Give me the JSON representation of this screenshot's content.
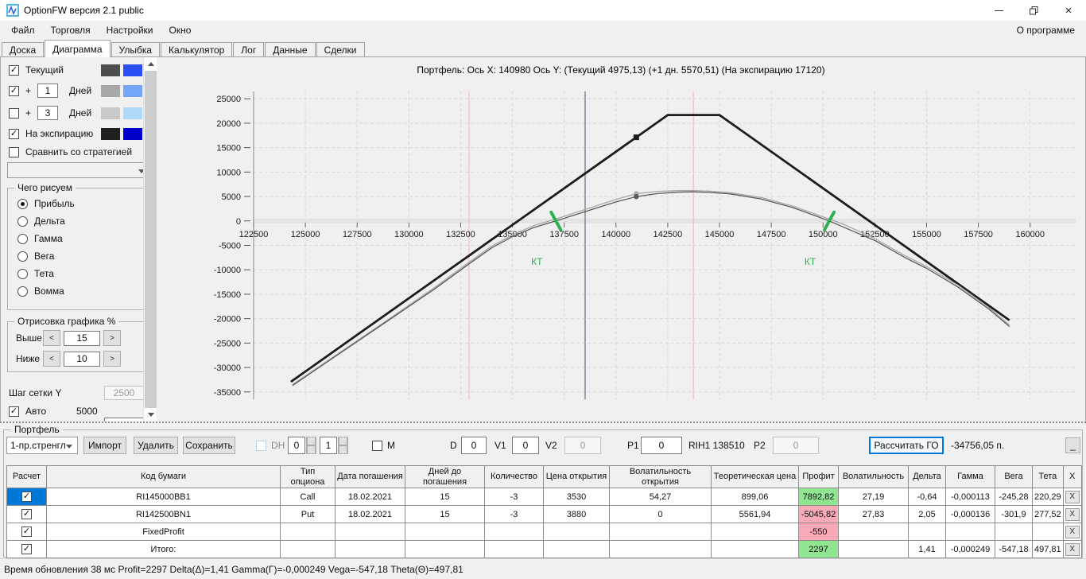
{
  "window": {
    "title": "OptionFW версия 2.1 public"
  },
  "menu": {
    "items": [
      "Файл",
      "Торговля",
      "Настройки",
      "Окно"
    ],
    "right": "О программе"
  },
  "tabs": {
    "items": [
      "Доска",
      "Диаграмма",
      "Улыбка",
      "Калькулятор",
      "Лог",
      "Данные",
      "Сделки"
    ],
    "active": "Диаграмма"
  },
  "sidebar": {
    "toggles": [
      {
        "label": "Текущий",
        "checked": true,
        "swatches": [
          "#4d4d4d",
          "#2b4df5"
        ]
      },
      {
        "prefix": "+",
        "value": "1",
        "label": "Дней",
        "checked": true,
        "swatches": [
          "#a8a8a8",
          "#74a5f7"
        ]
      },
      {
        "prefix": "+",
        "value": "3",
        "label": "Дней",
        "checked": false,
        "swatches": [
          "#c9c9c9",
          "#aed9fb"
        ]
      },
      {
        "label": "На экспирацию",
        "checked": true,
        "swatches": [
          "#1f1f1f",
          "#0000cc"
        ]
      },
      {
        "label": "Сравнить со стратегией",
        "checked": false
      }
    ],
    "strategy_dropdown_value": "",
    "draw_group": {
      "title": "Чего рисуем",
      "options": [
        "Прибыль",
        "Дельта",
        "Гамма",
        "Вега",
        "Тета",
        "Вомма"
      ],
      "selected": "Прибыль"
    },
    "range_group": {
      "title": "Отрисовка графика %",
      "rows": [
        {
          "label": "Выше",
          "value": "15"
        },
        {
          "label": "Ниже",
          "value": "10"
        }
      ],
      "dec_label": "<",
      "inc_label": ">"
    },
    "grid": {
      "label": "Шаг сетки Y",
      "value": "2500",
      "auto_label": "Авто",
      "auto_checked": true,
      "auto_value": "5000"
    }
  },
  "chart_header": "Портфель: Ось X: 140980 Ось Y:  (Текущий 4975,13)  (+1 дн. 5570,51)  (На экспирацию 17120)",
  "chart_data": {
    "type": "line",
    "title": "Портфель: Ось X: 140980 Ось Y: (Текущий 4975,13) (+1 дн. 5570,51) (На экспирацию 17120)",
    "x_axis": {
      "min": 122500,
      "max": 162200,
      "tick_step": 2500,
      "ticks": [
        122500,
        125000,
        127500,
        130000,
        132500,
        135000,
        137500,
        140000,
        142500,
        145000,
        147500,
        150000,
        152500,
        155000,
        157500,
        160000
      ]
    },
    "y_axis": {
      "min": -36500,
      "max": 26500,
      "tick_step": 5000,
      "ticks": [
        25000,
        20000,
        15000,
        10000,
        5000,
        0,
        -5000,
        -10000,
        -15000,
        -20000,
        -25000,
        -30000,
        -35000
      ]
    },
    "x_cursor": 140980,
    "underlying_line": {
      "x": 138510,
      "color": "#98a2ac"
    },
    "pink_lines": {
      "x": [
        132900,
        143740
      ],
      "color": "#f7bac7"
    },
    "breakeven_marks": [
      {
        "x": 137100,
        "label": "КТ",
        "dir": "back"
      },
      {
        "x": 150300,
        "label": "КТ",
        "dir": "fwd"
      }
    ],
    "breakeven_color": "#2fb050",
    "grid_on": true,
    "series": [
      {
        "name": "На экспирацию",
        "color": "#1c1c1c",
        "width": 2.8,
        "marker": {
          "x": 140980,
          "y": 17120,
          "shape": "square"
        },
        "points": [
          [
            124300,
            -32920
          ],
          [
            142500,
            21680
          ],
          [
            145000,
            21680
          ],
          [
            159000,
            -20320
          ]
        ]
      },
      {
        "name": "+1 Дней",
        "color": "#a8a8a8",
        "width": 1.3,
        "marker": {
          "x": 140980,
          "y": 5570.51,
          "shape": "circle"
        },
        "points": [
          [
            124376,
            -33500
          ],
          [
            126250,
            -28100
          ],
          [
            128750,
            -20900
          ],
          [
            131250,
            -13600
          ],
          [
            132837,
            -8650
          ],
          [
            134000,
            -5150
          ],
          [
            135000,
            -2850
          ],
          [
            136000,
            -1000
          ],
          [
            137100,
            400
          ],
          [
            138510,
            2350
          ],
          [
            140000,
            4400
          ],
          [
            140980,
            5570
          ],
          [
            142000,
            6050
          ],
          [
            143000,
            6200
          ],
          [
            143700,
            6230
          ],
          [
            144500,
            6100
          ],
          [
            145500,
            5800
          ],
          [
            147000,
            4800
          ],
          [
            148500,
            3100
          ],
          [
            150300,
            400
          ],
          [
            151000,
            -700
          ],
          [
            152500,
            -3600
          ],
          [
            154000,
            -7200
          ],
          [
            155000,
            -9300
          ],
          [
            156500,
            -13100
          ],
          [
            158000,
            -17700
          ],
          [
            159000,
            -21300
          ]
        ]
      },
      {
        "name": "Текущий",
        "color": "#5a5a5a",
        "width": 1.3,
        "marker": {
          "x": 140980,
          "y": 4975.13,
          "shape": "circle"
        },
        "points": [
          [
            124376,
            -33700
          ],
          [
            126250,
            -28300
          ],
          [
            128750,
            -21100
          ],
          [
            131250,
            -13900
          ],
          [
            132837,
            -9000
          ],
          [
            134000,
            -5500
          ],
          [
            135000,
            -3200
          ],
          [
            136000,
            -1400
          ],
          [
            137100,
            0
          ],
          [
            138510,
            1900
          ],
          [
            140000,
            3900
          ],
          [
            140980,
            4975
          ],
          [
            142000,
            5600
          ],
          [
            143000,
            5900
          ],
          [
            143700,
            5960
          ],
          [
            144500,
            5850
          ],
          [
            145500,
            5550
          ],
          [
            147000,
            4500
          ],
          [
            148500,
            2800
          ],
          [
            150300,
            0
          ],
          [
            151500,
            -2200
          ],
          [
            152500,
            -4000
          ],
          [
            154000,
            -7600
          ],
          [
            155000,
            -9700
          ],
          [
            156500,
            -13500
          ],
          [
            158000,
            -18000
          ],
          [
            159000,
            -21600
          ]
        ]
      }
    ]
  },
  "portfolio": {
    "group_title": "Портфель",
    "preset_dropdown": "1-пр.стренгл",
    "import_btn": "Импорт",
    "delete_btn": "Удалить",
    "save_btn": "Сохранить",
    "dh": {
      "label": "DH",
      "checked": false,
      "disabled": true
    },
    "spinner1": "0",
    "spinner2": "1",
    "m": {
      "label": "M",
      "checked": false
    },
    "d": {
      "label": "D",
      "value": "0"
    },
    "v1": {
      "label": "V1",
      "value": "0"
    },
    "v2": {
      "label": "V2",
      "value": "0",
      "disabled": true
    },
    "p1": {
      "label": "P1",
      "value": "0"
    },
    "instrument": "RIH1 138510",
    "p2": {
      "label": "P2",
      "value": "0",
      "disabled": true
    },
    "calc_button": "Рассчитать ГО",
    "margin_value": "-34756,05 п.",
    "collapse_button": "_"
  },
  "table": {
    "headers": [
      "Расчет",
      "Код бумаги",
      "Тип опциона",
      "Дата погашения",
      "Дней до погашения",
      "Количество",
      "Цена открытия",
      "Волатильность открытия",
      "Теоретическая цена",
      "Профит",
      "Волатильность",
      "Дельта",
      "Гамма",
      "Вега",
      "Тета",
      "X"
    ],
    "row_action": "X",
    "rows": [
      {
        "checked": true,
        "selected": true,
        "profit_color": "green",
        "cells": [
          "RI145000BB1",
          "Call",
          "18.02.2021",
          "15",
          "-3",
          "3530",
          "54,27",
          "899,06",
          "7892,82",
          "27,19",
          "-0,64",
          "-0,000113",
          "-245,28",
          "220,29"
        ]
      },
      {
        "checked": true,
        "selected": false,
        "profit_color": "red",
        "cells": [
          "RI142500BN1",
          "Put",
          "18.02.2021",
          "15",
          "-3",
          "3880",
          "0",
          "5561,94",
          "-5045,82",
          "27,83",
          "2,05",
          "-0,000136",
          "-301,9",
          "277,52"
        ]
      },
      {
        "checked": true,
        "selected": false,
        "profit_color": "red",
        "cells": [
          "FixedProfit",
          "",
          "",
          "",
          "",
          "",
          "",
          "",
          "-550",
          "",
          "",
          "",
          "",
          ""
        ]
      },
      {
        "checked": true,
        "selected": false,
        "profit_color": "green",
        "cells": [
          "Итого:",
          "",
          "",
          "",
          "",
          "",
          "",
          "",
          "2297",
          "",
          "1,41",
          "-0,000249",
          "-547,18",
          "497,81"
        ]
      }
    ]
  },
  "statusbar": "Время обновления 38 мс   Profit=2297 Delta(Δ)=1,41 Gamma(Γ)=-0,000249 Vega=-547,18 Theta(Θ)=497,81"
}
